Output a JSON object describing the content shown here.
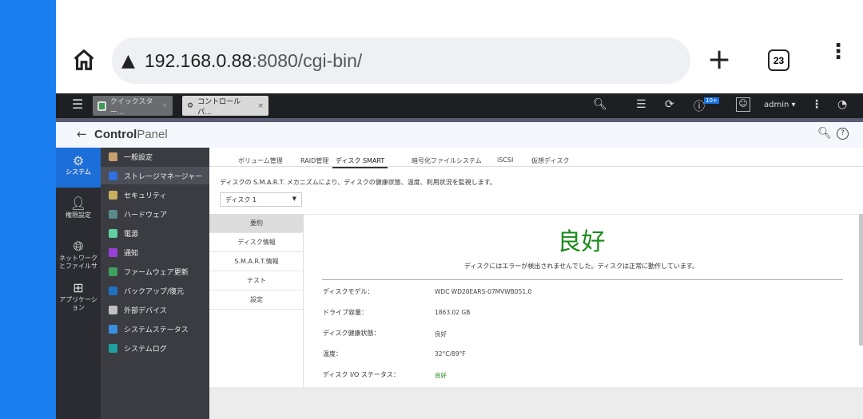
{
  "browser": {
    "url_host": "192.168.0.88",
    "url_rest": ":8080/cgi-bin/",
    "tab_count": "23",
    "icons": [
      "home-icon",
      "warning-icon",
      "plus-icon",
      "more-vert-icon"
    ]
  },
  "qts_bar": {
    "tabs": [
      {
        "label": "クイックスター...",
        "active": false
      },
      {
        "label": "コントロールパ...",
        "active": true
      }
    ],
    "notification_badge": "10+",
    "user": "admin"
  },
  "header": {
    "title_bold": "Control",
    "title_light": "Panel"
  },
  "nav": {
    "items": [
      {
        "label": "システム",
        "icon": "gear-icon",
        "selected": true
      },
      {
        "label": "権限設定",
        "icon": "user-icon"
      },
      {
        "label": "ネットワーク\nとファイルサ",
        "icon": "globe-icon"
      },
      {
        "label": "アプリケーション",
        "icon": "apps-icon"
      }
    ]
  },
  "submenu": {
    "items": [
      {
        "label": "一般設定",
        "color": "#c9a070"
      },
      {
        "label": "ストレージマネージャー",
        "color": "#2f6fe0",
        "selected": true
      },
      {
        "label": "セキュリティ",
        "color": "#c8b060"
      },
      {
        "label": "ハードウェア",
        "color": "#5a8a8a"
      },
      {
        "label": "電源",
        "color": "#5fd0a0"
      },
      {
        "label": "通知",
        "color": "#9a40d8"
      },
      {
        "label": "ファームウェア更新",
        "color": "#40a060"
      },
      {
        "label": "バックアップ/復元",
        "color": "#2070c0"
      },
      {
        "label": "外部デバイス",
        "color": "#c0c0c0"
      },
      {
        "label": "システムステータス",
        "color": "#3a90e0"
      },
      {
        "label": "システムログ",
        "color": "#20a0a0"
      }
    ]
  },
  "tabs": [
    {
      "label": "ボリューム管理"
    },
    {
      "label": "RAID管理"
    },
    {
      "label": "ディスク SMART",
      "active": true
    },
    {
      "label": "暗号化ファイルシステム"
    },
    {
      "label": "iSCSI"
    },
    {
      "label": "仮想ディスク"
    }
  ],
  "description": "ディスクの S.M.A.R.T. メカニズムにより、ディスクの健康状態、温度、利用状況を監視します。",
  "disk_select": "ディスク 1",
  "side_tabs": [
    {
      "label": "要約",
      "active": true
    },
    {
      "label": "ディスク情報"
    },
    {
      "label": "S.M.A.R.T.情報"
    },
    {
      "label": "テスト"
    },
    {
      "label": "設定"
    }
  ],
  "summary": {
    "status": "良好",
    "status_color": "#1a8a1a",
    "message": "ディスクにはエラーが検出されませんでした。ディスクは正常に動作しています。",
    "rows": [
      {
        "label": "ディスクモデル：",
        "value": "WDC WD20EARS-07MVWB051.0"
      },
      {
        "label": "ドライブ容量：",
        "value": "1863.02 GB"
      },
      {
        "label": "ディスク健康状態：",
        "value": "良好"
      },
      {
        "label": "温度：",
        "value": "32°C/89°F"
      },
      {
        "label": "ディスク I/O ステータス：",
        "value": "良好"
      }
    ]
  }
}
